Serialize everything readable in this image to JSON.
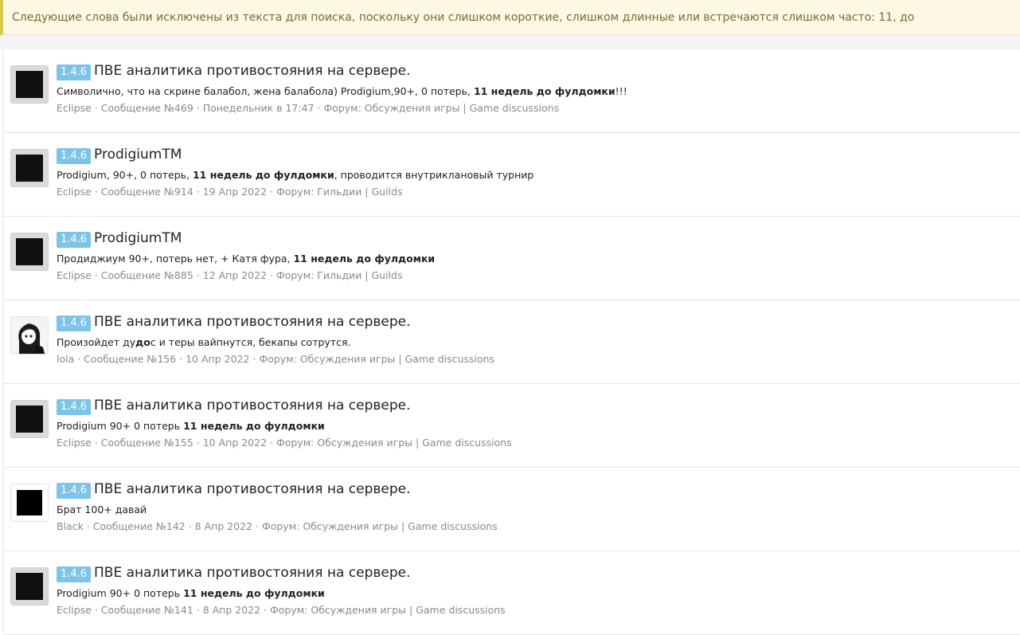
{
  "notice": {
    "text": "Следующие слова были исключены из текста для поиска, поскольку они слишком короткие, слишком длинные или встречаются слишком часто: 11, до"
  },
  "results": [
    {
      "avatar": "black-square",
      "badge": "1.4.6",
      "title": "ПВЕ аналитика противостояния на сервере.",
      "snippet_parts": [
        {
          "text": "Символично, что на скрине балабол, жена балабола) Prodigium,90+, 0 потерь, ",
          "bold": false
        },
        {
          "text": "11 недель до фулдомки",
          "bold": true
        },
        {
          "text": "!!!",
          "bold": false
        }
      ],
      "meta": "Eclipse · Сообщение №469 · Понедельник в 17:47 · Форум: Обсуждения игры | Game discussions"
    },
    {
      "avatar": "black-square",
      "badge": "1.4.6",
      "title": "ProdigiumTM",
      "snippet_parts": [
        {
          "text": "Prodigium, 90+, 0 потерь, ",
          "bold": false
        },
        {
          "text": "11 недель до фулдомки",
          "bold": true
        },
        {
          "text": ", проводится внутриклановый турнир",
          "bold": false
        }
      ],
      "meta": "Eclipse · Сообщение №914 · 19 Апр 2022 · Форум: Гильдии | Guilds"
    },
    {
      "avatar": "black-square",
      "badge": "1.4.6",
      "title": "ProdigiumTM",
      "snippet_parts": [
        {
          "text": "Продиджиум 90+, потерь нет, + Катя фура, ",
          "bold": false
        },
        {
          "text": "11 недель до фулдомки",
          "bold": true
        }
      ],
      "meta": "Eclipse · Сообщение №885 · 12 Апр 2022 · Форум: Гильдии | Guilds"
    },
    {
      "avatar": "girl",
      "badge": "1.4.6",
      "title": "ПВЕ аналитика противостояния на сервере.",
      "snippet_parts": [
        {
          "text": "Произойдет ду",
          "bold": false
        },
        {
          "text": "до",
          "bold": true
        },
        {
          "text": "с и теры вайпнутся, бекапы сотрутся.",
          "bold": false
        }
      ],
      "meta": "lola · Сообщение №156 · 10 Апр 2022 · Форум: Обсуждения игры | Game discussions"
    },
    {
      "avatar": "black-square",
      "badge": "1.4.6",
      "title": "ПВЕ аналитика противостояния на сервере.",
      "snippet_parts": [
        {
          "text": "Prodigium 90+ 0 потерь ",
          "bold": false
        },
        {
          "text": "11 недель до фулдомки",
          "bold": true
        }
      ],
      "meta": "Eclipse · Сообщение №155 · 10 Апр 2022 · Форум: Обсуждения игры | Game discussions"
    },
    {
      "avatar": "white-black-square",
      "badge": "1.4.6",
      "title": "ПВЕ аналитика противостояния на сервере.",
      "snippet_parts": [
        {
          "text": "Брат 100+ давай",
          "bold": false
        }
      ],
      "meta": "Black · Сообщение №142 · 8 Апр 2022 · Форум: Обсуждения игры | Game discussions"
    },
    {
      "avatar": "black-square",
      "badge": "1.4.6",
      "title": "ПВЕ аналитика противостояния на сервере.",
      "snippet_parts": [
        {
          "text": "Prodigium 90+ 0 потерь ",
          "bold": false
        },
        {
          "text": "11 недель до фулдомки",
          "bold": true
        }
      ],
      "meta": "Eclipse · Сообщение №141 · 8 Апр 2022 · Форум: Обсуждения игры | Game discussions"
    }
  ]
}
